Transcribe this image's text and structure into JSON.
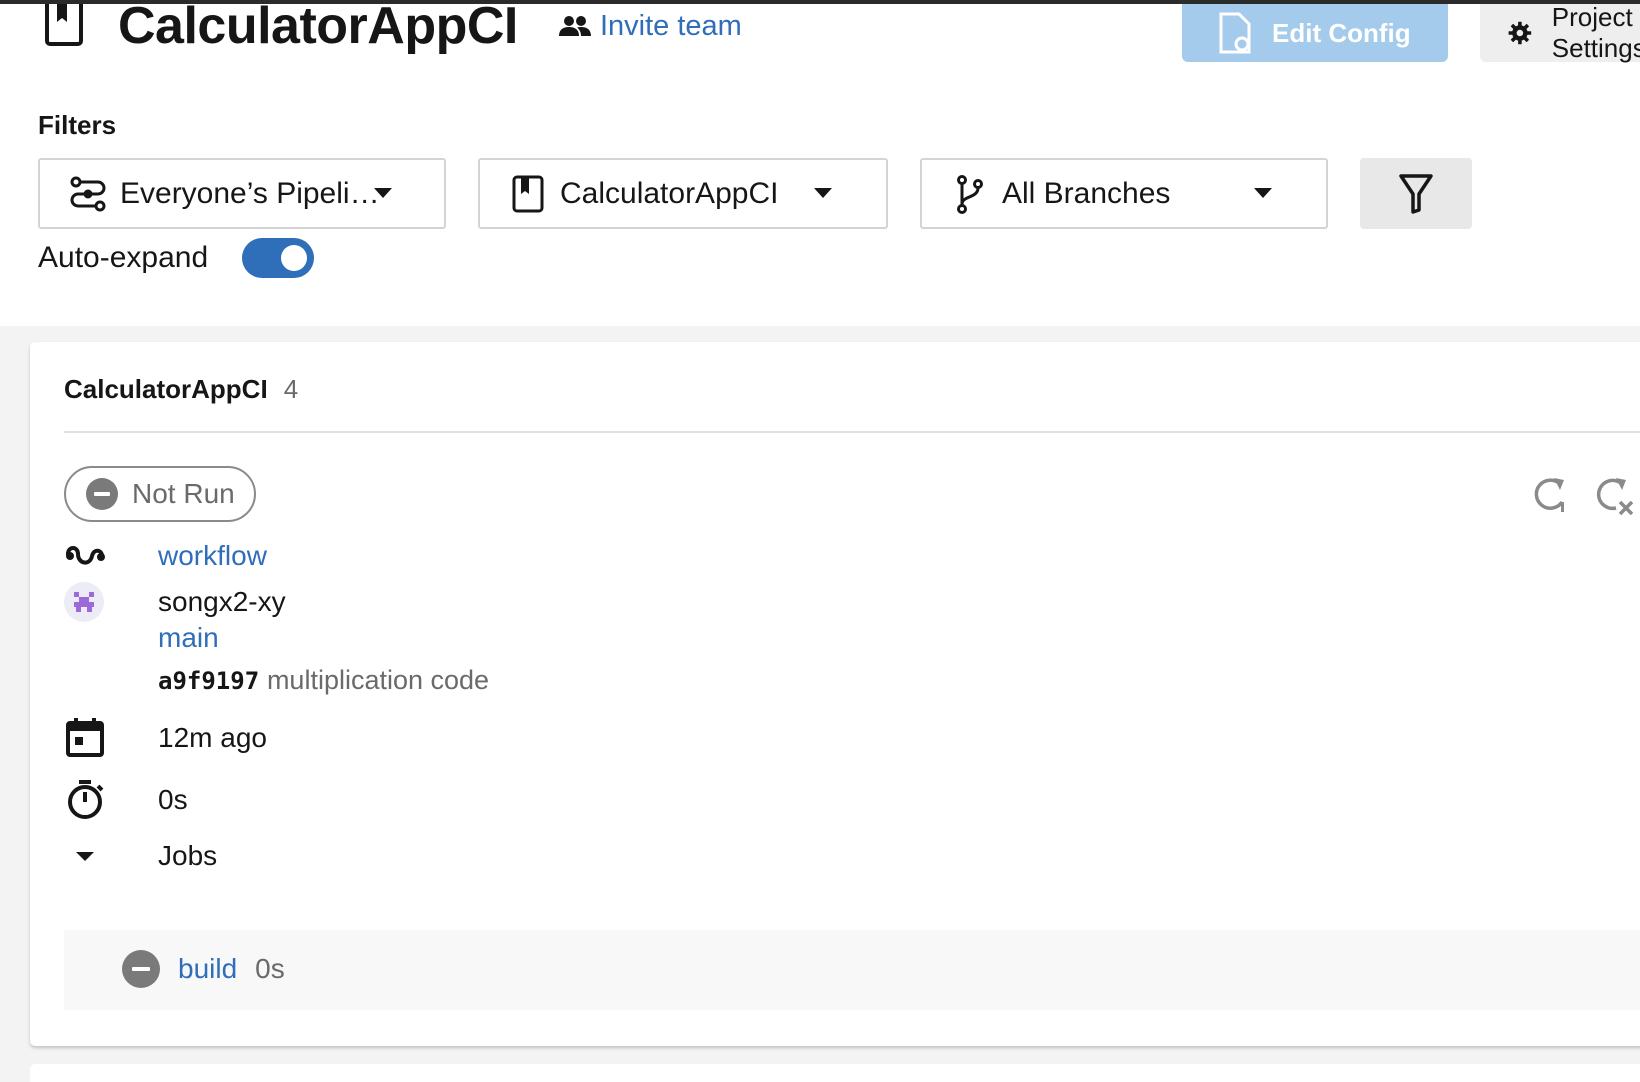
{
  "header": {
    "project_title": "CalculatorAppCI",
    "invite_label": "Invite team",
    "edit_config_label": "Edit Config",
    "project_settings_label": "Project Settings"
  },
  "filters": {
    "label": "Filters",
    "pipelines_value": "Everyone’s Pipeli…",
    "project_value": "CalculatorAppCI",
    "branches_value": "All Branches",
    "auto_expand_label": "Auto-expand",
    "auto_expand_on": true
  },
  "pipeline": {
    "project_name": "CalculatorAppCI",
    "number": "4",
    "status": "Not Run",
    "workflow": "workflow",
    "author": "songx2-xy",
    "branch": "main",
    "commit_hash": "a9f9197",
    "commit_message": "multiplication code",
    "started": "12m ago",
    "duration": "0s",
    "jobs_label": "Jobs",
    "jobs": [
      {
        "name": "build",
        "duration": "0s",
        "status": "Not Run"
      }
    ]
  },
  "colors": {
    "accent": "#2f6eb8",
    "edit_config_bg": "#a4cbec",
    "status_gray": "#7a7a7a"
  },
  "icons": {
    "project": "bookmark-icon",
    "invite": "people-icon",
    "edit_config": "file-gear-icon",
    "settings": "gear-icon",
    "pipelines": "pipeline-icon",
    "branches": "branch-icon",
    "filter": "funnel-icon",
    "rerun": "rerun-icon",
    "cancel": "cancel-icon",
    "workflow": "workflow-icon",
    "calendar": "calendar-icon",
    "timer": "stopwatch-icon"
  }
}
